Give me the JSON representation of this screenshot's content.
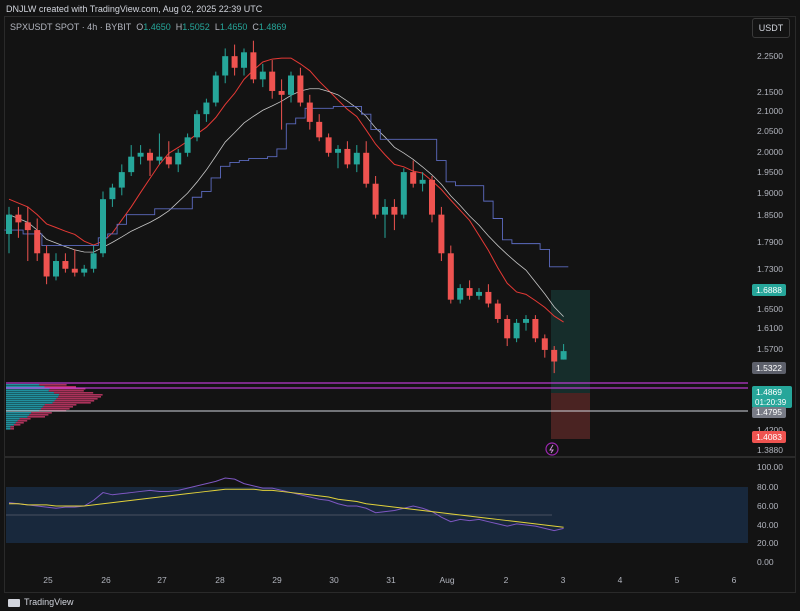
{
  "header": {
    "attribution": "DNJLW created with TradingView.com, Aug 02, 2025 22:39 UTC"
  },
  "legend": {
    "symbol": "SPXUSDT SPOT · 4h · BYBIT",
    "o_label": "O",
    "o": "1.4650",
    "h_label": "H",
    "h": "1.5052",
    "l_label": "L",
    "l": "1.4650",
    "c_label": "C",
    "c": "1.4869"
  },
  "currency_button": "USDT",
  "price_axis": {
    "ticks": [
      "2.2500",
      "2.1500",
      "2.1000",
      "2.0500",
      "2.0000",
      "1.9500",
      "1.9000",
      "1.8500",
      "1.7900",
      "1.7300",
      "1.6500",
      "1.6100",
      "1.5700",
      "1.4200",
      "1.3880"
    ],
    "badges": {
      "tp": "1.6888",
      "level": "1.5322",
      "current": "1.4869",
      "countdown": "01:20:39",
      "support": "1.4795",
      "stop": "1.4083"
    }
  },
  "osc_axis": {
    "ticks": [
      "100.00",
      "80.00",
      "60.00",
      "40.00",
      "20.00",
      "0.00"
    ]
  },
  "time_axis": {
    "ticks": [
      "25",
      "26",
      "27",
      "28",
      "29",
      "30",
      "31",
      "Aug",
      "2",
      "3",
      "4",
      "5",
      "6"
    ]
  },
  "footer": {
    "brand": "TradingView"
  },
  "chart_data": {
    "type": "candlestick",
    "symbol": "SPXUSDT",
    "interval": "4h",
    "exchange": "BYBIT",
    "ohlc_last": {
      "open": 1.465,
      "high": 1.5052,
      "low": 1.465,
      "close": 1.4869
    },
    "price_range": [
      1.38,
      2.3
    ],
    "levels": {
      "take_profit": 1.6888,
      "level": 1.5322,
      "current": 1.4869,
      "support": 1.4795,
      "stop": 1.4083
    },
    "candles": [
      [
        1.79,
        1.86,
        1.74,
        1.84
      ],
      [
        1.84,
        1.86,
        1.78,
        1.82
      ],
      [
        1.82,
        1.86,
        1.72,
        1.8
      ],
      [
        1.8,
        1.83,
        1.72,
        1.74
      ],
      [
        1.74,
        1.76,
        1.66,
        1.68
      ],
      [
        1.68,
        1.74,
        1.67,
        1.72
      ],
      [
        1.72,
        1.74,
        1.69,
        1.7
      ],
      [
        1.7,
        1.75,
        1.68,
        1.69
      ],
      [
        1.69,
        1.71,
        1.68,
        1.7
      ],
      [
        1.7,
        1.76,
        1.69,
        1.74
      ],
      [
        1.74,
        1.9,
        1.73,
        1.88
      ],
      [
        1.88,
        1.92,
        1.86,
        1.91
      ],
      [
        1.91,
        1.97,
        1.89,
        1.95
      ],
      [
        1.95,
        2.02,
        1.94,
        1.99
      ],
      [
        1.99,
        2.02,
        1.97,
        2.0
      ],
      [
        2.0,
        2.01,
        1.94,
        1.98
      ],
      [
        1.98,
        2.05,
        1.97,
        1.99
      ],
      [
        1.99,
        2.03,
        1.96,
        1.97
      ],
      [
        1.97,
        2.01,
        1.95,
        2.0
      ],
      [
        2.0,
        2.05,
        1.99,
        2.04
      ],
      [
        2.04,
        2.11,
        2.03,
        2.1
      ],
      [
        2.1,
        2.14,
        2.08,
        2.13
      ],
      [
        2.13,
        2.21,
        2.12,
        2.2
      ],
      [
        2.2,
        2.27,
        2.18,
        2.25
      ],
      [
        2.25,
        2.28,
        2.2,
        2.22
      ],
      [
        2.22,
        2.27,
        2.2,
        2.26
      ],
      [
        2.26,
        2.29,
        2.18,
        2.19
      ],
      [
        2.19,
        2.23,
        2.17,
        2.21
      ],
      [
        2.21,
        2.24,
        2.14,
        2.16
      ],
      [
        2.16,
        2.19,
        2.06,
        2.15
      ],
      [
        2.15,
        2.21,
        2.13,
        2.2
      ],
      [
        2.2,
        2.22,
        2.12,
        2.13
      ],
      [
        2.13,
        2.15,
        2.06,
        2.08
      ],
      [
        2.08,
        2.1,
        2.03,
        2.04
      ],
      [
        2.04,
        2.05,
        1.99,
        2.0
      ],
      [
        2.0,
        2.02,
        1.96,
        2.01
      ],
      [
        2.01,
        2.03,
        1.96,
        1.97
      ],
      [
        1.97,
        2.02,
        1.95,
        2.0
      ],
      [
        2.0,
        2.03,
        1.91,
        1.92
      ],
      [
        1.92,
        1.94,
        1.83,
        1.84
      ],
      [
        1.84,
        1.88,
        1.78,
        1.86
      ],
      [
        1.86,
        1.88,
        1.8,
        1.84
      ],
      [
        1.84,
        1.96,
        1.83,
        1.95
      ],
      [
        1.95,
        1.98,
        1.91,
        1.92
      ],
      [
        1.92,
        1.95,
        1.9,
        1.93
      ],
      [
        1.93,
        1.94,
        1.82,
        1.84
      ],
      [
        1.84,
        1.86,
        1.72,
        1.74
      ],
      [
        1.74,
        1.76,
        1.61,
        1.62
      ],
      [
        1.62,
        1.66,
        1.61,
        1.65
      ],
      [
        1.65,
        1.67,
        1.62,
        1.63
      ],
      [
        1.63,
        1.65,
        1.62,
        1.64
      ],
      [
        1.64,
        1.66,
        1.6,
        1.61
      ],
      [
        1.61,
        1.62,
        1.56,
        1.57
      ],
      [
        1.57,
        1.58,
        1.5,
        1.52
      ],
      [
        1.52,
        1.57,
        1.51,
        1.56
      ],
      [
        1.56,
        1.58,
        1.54,
        1.57
      ],
      [
        1.57,
        1.58,
        1.51,
        1.52
      ],
      [
        1.52,
        1.53,
        1.47,
        1.49
      ],
      [
        1.49,
        1.5,
        1.43,
        1.46
      ],
      [
        1.465,
        1.5052,
        1.465,
        1.4869
      ]
    ],
    "rsi": [
      53,
      52,
      51,
      50,
      49,
      48,
      49,
      49,
      50,
      55,
      62,
      60,
      61,
      62,
      63,
      64,
      63,
      63,
      64,
      66,
      68,
      70,
      72,
      75,
      74,
      70,
      68,
      66,
      66,
      64,
      62,
      60,
      58,
      56,
      55,
      52,
      50,
      50,
      48,
      44,
      45,
      46,
      48,
      50,
      48,
      45,
      40,
      36,
      38,
      37,
      38,
      36,
      34,
      32,
      34,
      33,
      32,
      30,
      28,
      30
    ],
    "rsi_ma": [
      52,
      52,
      51,
      51,
      51,
      50,
      50,
      50,
      50,
      51,
      52,
      53,
      54,
      55,
      56,
      57,
      58,
      59,
      60,
      61,
      62,
      63,
      64,
      65,
      65,
      65,
      65,
      64,
      64,
      63,
      62,
      61,
      60,
      59,
      58,
      56,
      55,
      54,
      52,
      51,
      50,
      49,
      48,
      47,
      46,
      45,
      44,
      43,
      42,
      41,
      40,
      39,
      38,
      37,
      36,
      35,
      34,
      33,
      32,
      31
    ],
    "rsi_range": [
      0,
      100
    ],
    "rsi_band": [
      20,
      80
    ],
    "rsi_midline": 50
  }
}
